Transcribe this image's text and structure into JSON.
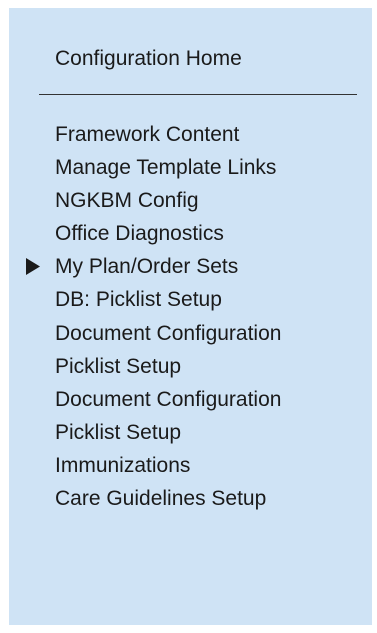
{
  "nav": {
    "home_label": "Configuration Home",
    "selected_marker_icon": "play-triangle-icon",
    "items": [
      {
        "label": "Framework Content",
        "selected": false
      },
      {
        "label": "Manage Template Links",
        "selected": false
      },
      {
        "label": "NGKBM Config",
        "selected": false
      },
      {
        "label": "Office Diagnostics",
        "selected": false
      },
      {
        "label": "My Plan/Order Sets",
        "selected": true
      },
      {
        "label": "DB: Picklist Setup",
        "selected": false
      },
      {
        "label": "Document Configuration",
        "selected": false
      },
      {
        "label": "Picklist Setup",
        "selected": false
      },
      {
        "label": "Document Configuration",
        "selected": false
      },
      {
        "label": "Picklist Setup",
        "selected": false
      },
      {
        "label": "Immunizations",
        "selected": false
      },
      {
        "label": "Care Guidelines Setup",
        "selected": false
      }
    ]
  },
  "colors": {
    "panel_background": "#cfe3f5",
    "text": "#1a1a1a",
    "divider": "#333333"
  }
}
